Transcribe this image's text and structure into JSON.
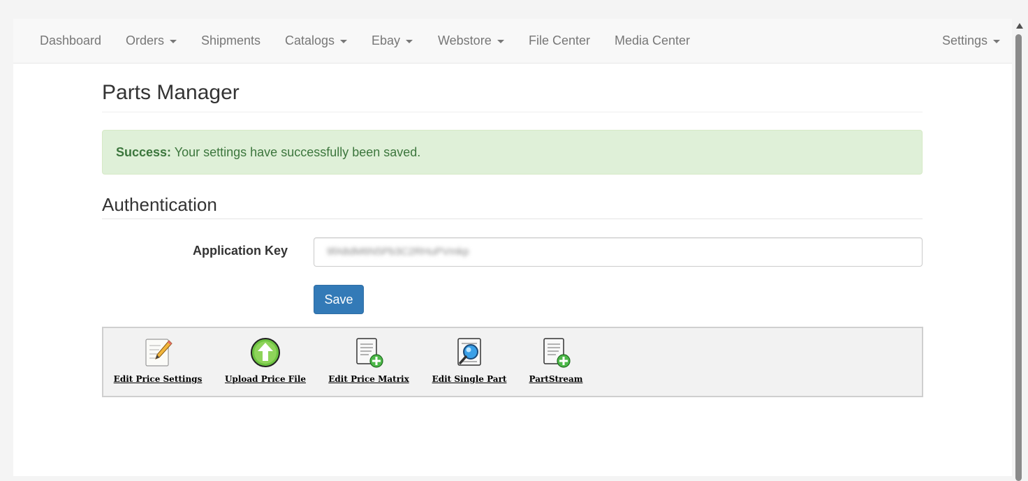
{
  "nav": {
    "items": [
      {
        "label": "Dashboard",
        "dropdown": false
      },
      {
        "label": "Orders",
        "dropdown": true
      },
      {
        "label": "Shipments",
        "dropdown": false
      },
      {
        "label": "Catalogs",
        "dropdown": true
      },
      {
        "label": "Ebay",
        "dropdown": true
      },
      {
        "label": "Webstore",
        "dropdown": true
      },
      {
        "label": "File Center",
        "dropdown": false
      },
      {
        "label": "Media Center",
        "dropdown": false
      }
    ],
    "settings": {
      "label": "Settings",
      "dropdown": true
    }
  },
  "page": {
    "title": "Parts Manager"
  },
  "alert": {
    "strong": "Success:",
    "message": "Your settings have successfully been saved."
  },
  "auth": {
    "section_title": "Authentication",
    "app_key_label": "Application Key",
    "app_key_value": "9fA8dM6N5Pb3C2RHuPVmkp",
    "save_label": "Save"
  },
  "toolbar": {
    "items": [
      {
        "label": "Edit Price Settings",
        "icon": "edit-document-pencil-icon"
      },
      {
        "label": "Upload Price File",
        "icon": "upload-arrow-icon"
      },
      {
        "label": "Edit Price Matrix",
        "icon": "document-add-icon"
      },
      {
        "label": "Edit Single Part",
        "icon": "document-search-icon"
      },
      {
        "label": "PartStream",
        "icon": "document-add-icon"
      }
    ]
  },
  "colors": {
    "primary": "#337ab7",
    "success_bg": "#dff0d8",
    "success_text": "#3c763d",
    "navbar_bg": "#f8f8f8"
  }
}
